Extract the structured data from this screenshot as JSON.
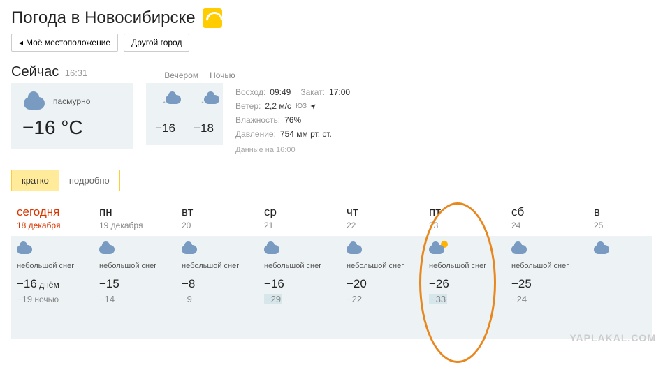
{
  "header": {
    "title": "Погода в Новосибирске"
  },
  "location": {
    "my_location": "Моё местоположение",
    "other_city": "Другой город"
  },
  "now": {
    "label": "Сейчас",
    "time": "16:31",
    "evening_label": "Вечером",
    "night_label": "Ночью",
    "condition": "пасмурно",
    "temp": "−16 °C",
    "evening_temp": "−16",
    "night_temp": "−18"
  },
  "details": {
    "sunrise_label": "Восход:",
    "sunrise": "09:49",
    "sunset_label": "Закат:",
    "sunset": "17:00",
    "wind_label": "Ветер:",
    "wind": "2,2 м/с",
    "wind_dir": "ЮЗ",
    "humidity_label": "Влажность:",
    "humidity": "76%",
    "pressure_label": "Давление:",
    "pressure": "754 мм рт. ст.",
    "data_note": "Данные на 16:00"
  },
  "tabs": {
    "brief": "кратко",
    "detailed": "подробно"
  },
  "forecast": [
    {
      "name": "сегодня",
      "date": "18 декабря",
      "today": true,
      "cond": "небольшой снег",
      "day_temp": "−16",
      "day_suffix": " днём",
      "night_temp": "−19",
      "night_suffix": " ночью",
      "has_sun": false,
      "cold_night": false
    },
    {
      "name": "пн",
      "date": "19 декабря",
      "today": false,
      "cond": "небольшой снег",
      "day_temp": "−15",
      "day_suffix": "",
      "night_temp": "−14",
      "night_suffix": "",
      "has_sun": false,
      "cold_night": false
    },
    {
      "name": "вт",
      "date": "20",
      "today": false,
      "cond": "небольшой снег",
      "day_temp": "−8",
      "day_suffix": "",
      "night_temp": "−9",
      "night_suffix": "",
      "has_sun": false,
      "cold_night": false
    },
    {
      "name": "ср",
      "date": "21",
      "today": false,
      "cond": "небольшой снег",
      "day_temp": "−16",
      "day_suffix": "",
      "night_temp": "−29",
      "night_suffix": "",
      "has_sun": false,
      "cold_night": true
    },
    {
      "name": "чт",
      "date": "22",
      "today": false,
      "cond": "небольшой снег",
      "day_temp": "−20",
      "day_suffix": "",
      "night_temp": "−22",
      "night_suffix": "",
      "has_sun": false,
      "cold_night": false
    },
    {
      "name": "пт",
      "date": "23",
      "today": false,
      "cond": "небольшой снег",
      "day_temp": "−26",
      "day_suffix": "",
      "night_temp": "−33",
      "night_suffix": "",
      "has_sun": true,
      "cold_night": true
    },
    {
      "name": "сб",
      "date": "24",
      "today": false,
      "cond": "небольшой снег",
      "day_temp": "−25",
      "day_suffix": "",
      "night_temp": "−24",
      "night_suffix": "",
      "has_sun": false,
      "cold_night": false
    },
    {
      "name": "в",
      "date": "25",
      "today": false,
      "cond": "",
      "day_temp": "",
      "day_suffix": "",
      "night_temp": "",
      "night_suffix": "",
      "has_sun": false,
      "cold_night": false
    }
  ],
  "watermark": "YAPLAKAL.COM"
}
